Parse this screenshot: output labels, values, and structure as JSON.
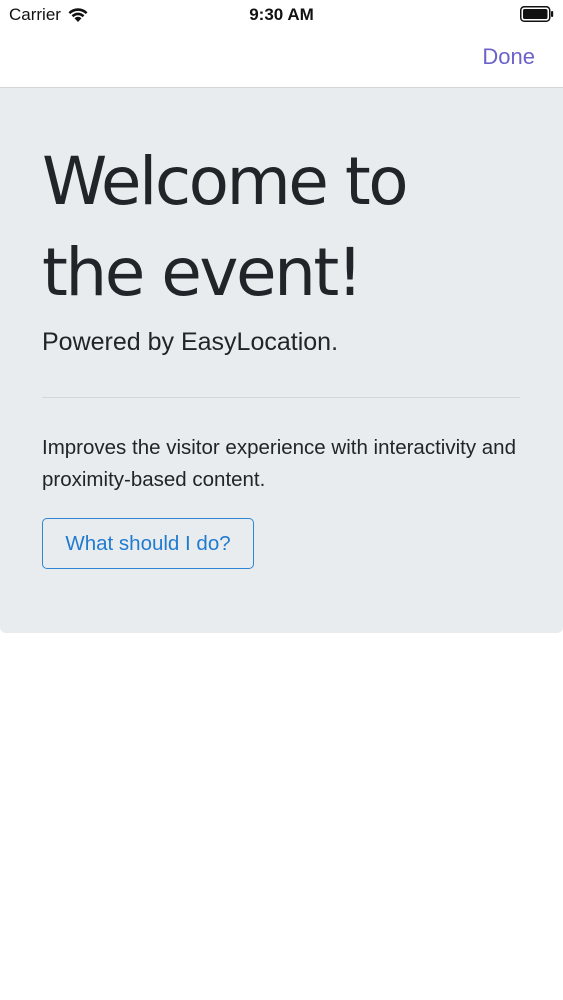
{
  "status_bar": {
    "carrier": "Carrier",
    "time": "9:30 AM",
    "wifi_icon": "wifi-icon",
    "battery_icon": "battery-icon"
  },
  "nav": {
    "done_label": "Done",
    "accent_color": "#6c63c9"
  },
  "card": {
    "title": "Welcome to the event!",
    "subtitle": "Powered by EasyLocation.",
    "description": "Improves the visitor experience with interactivity and proximity-based content.",
    "button_label": "What should I do?",
    "background_color": "#e9ecef",
    "button_color": "#1f7bd1"
  }
}
